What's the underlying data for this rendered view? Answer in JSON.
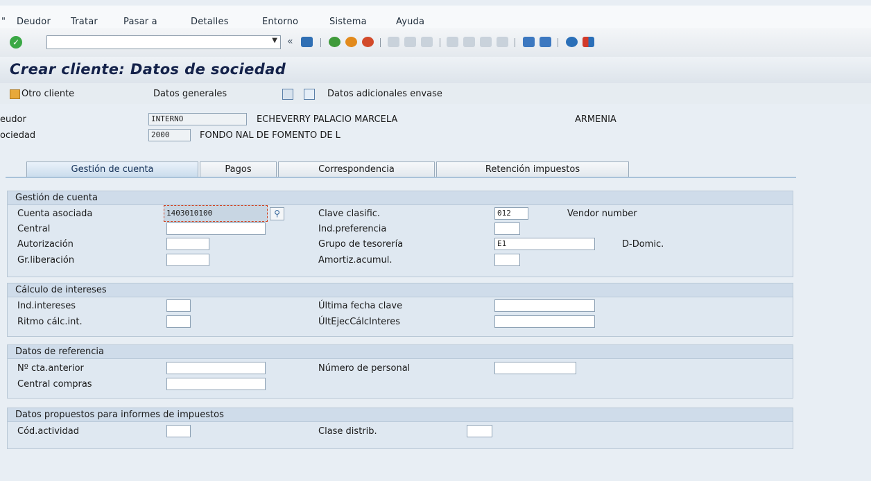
{
  "menu": {
    "items": [
      "Deudor",
      "Tratar",
      "Pasar a",
      "Detalles",
      "Entorno",
      "Sistema",
      "Ayuda"
    ],
    "underline": [
      "u",
      "T",
      "P",
      "D",
      "E",
      "S",
      "A"
    ]
  },
  "toolbar": {
    "command_value": "",
    "icons": [
      "enter-icon",
      "back-icon",
      "save-icon",
      "back-green-icon",
      "exit-orange-icon",
      "cancel-red-icon",
      "print-icon",
      "find-icon",
      "find-next-icon",
      "first-page-icon",
      "previous-page-icon",
      "next-page-icon",
      "last-page-icon",
      "create-session-icon",
      "generate-shortcut-icon",
      "help-icon",
      "customize-layout-icon"
    ]
  },
  "title": "Crear cliente: Datos de sociedad",
  "appbar": {
    "otro_cliente": "Otro cliente",
    "datos_generales": "Datos generales",
    "datos_adicionales": "Datos adicionales envase"
  },
  "header": {
    "deudor_label": "eudor",
    "deudor_value": "INTERNO",
    "deudor_name": "ECHEVERRY PALACIO MARCELA",
    "deudor_city": "ARMENIA",
    "sociedad_label": "ociedad",
    "sociedad_value": "2000",
    "sociedad_name": "FONDO NAL DE FOMENTO DE L"
  },
  "tabs": [
    "Gestión de cuenta",
    "Pagos",
    "Correspondencia",
    "Retención impuestos"
  ],
  "active_tab": 0,
  "gestion": {
    "title": "Gestión de cuenta",
    "cuenta_asociada_label": "Cuenta asociada",
    "cuenta_asociada_value": "1403010100",
    "central_label": "Central",
    "central_value": "",
    "autorizacion_label": "Autorización",
    "autorizacion_value": "",
    "grliberacion_label": "Gr.liberación",
    "grliberacion_value": "",
    "clave_label": "Clave clasific.",
    "clave_value": "012",
    "clave_desc": "Vendor number",
    "indpref_label": "Ind.preferencia",
    "indpref_value": "",
    "grupo_label": "Grupo de tesorería",
    "grupo_value": "E1",
    "grupo_desc": "D-Domic.",
    "amortiz_label": "Amortiz.acumul.",
    "amortiz_value": ""
  },
  "calculo": {
    "title": "Cálculo de intereses",
    "ind_label": "Ind.intereses",
    "ind_value": "",
    "ritmo_label": "Ritmo cálc.int.",
    "ritmo_value": "",
    "ultima_label": "Última fecha clave",
    "ultima_value": "",
    "ultejec_label": "ÚltEjecCálcInteres",
    "ultejec_value": ""
  },
  "referencia": {
    "title": "Datos de referencia",
    "cta_label": "Nº cta.anterior",
    "cta_value": "",
    "central_label": "Central compras",
    "central_value": "",
    "personal_label": "Número de personal",
    "personal_value": ""
  },
  "impuestos": {
    "title": "Datos propuestos para informes de impuestos",
    "actividad_label": "Cód.actividad",
    "actividad_value": "",
    "clase_label": "Clase distrib.",
    "clase_value": ""
  },
  "colors": {
    "title_text": "#14224a",
    "active_tab": "#c9dcec",
    "group_head": "#cfdcea",
    "enter_green": "#3aa845",
    "save_blue": "#2f6fb4"
  }
}
